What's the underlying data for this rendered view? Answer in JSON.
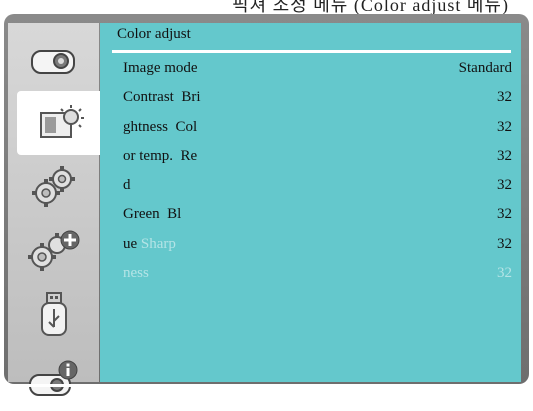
{
  "header_fragment": "픽쳐 조정 메뉴 (Color adjust 메뉴)",
  "sidebar": {
    "items": [
      {
        "icon": "projector-icon"
      },
      {
        "icon": "picture-adjust-icon",
        "active": true
      },
      {
        "icon": "gears-icon"
      },
      {
        "icon": "gears-plus-icon"
      },
      {
        "icon": "usb-icon"
      },
      {
        "icon": "projector-info-icon"
      }
    ]
  },
  "panel": {
    "title": "Color adjust",
    "rows": [
      {
        "label": "Image mode",
        "value": "Standard"
      },
      {
        "label": "Contrast  Bri",
        "value": "32"
      },
      {
        "label": "ghtness  Col",
        "value": "32"
      },
      {
        "label": "or temp.  Re",
        "value": "32"
      },
      {
        "label": "d",
        "value": "32"
      },
      {
        "label": "Green  Bl",
        "value": "32"
      },
      {
        "label": "ue",
        "label_dim": "Sharp",
        "value": "32"
      },
      {
        "label": "ness",
        "value": "32",
        "dim": true
      }
    ]
  },
  "colors": {
    "panel_bg": "#64c8cc",
    "dim_text": "#b4e4e6"
  }
}
